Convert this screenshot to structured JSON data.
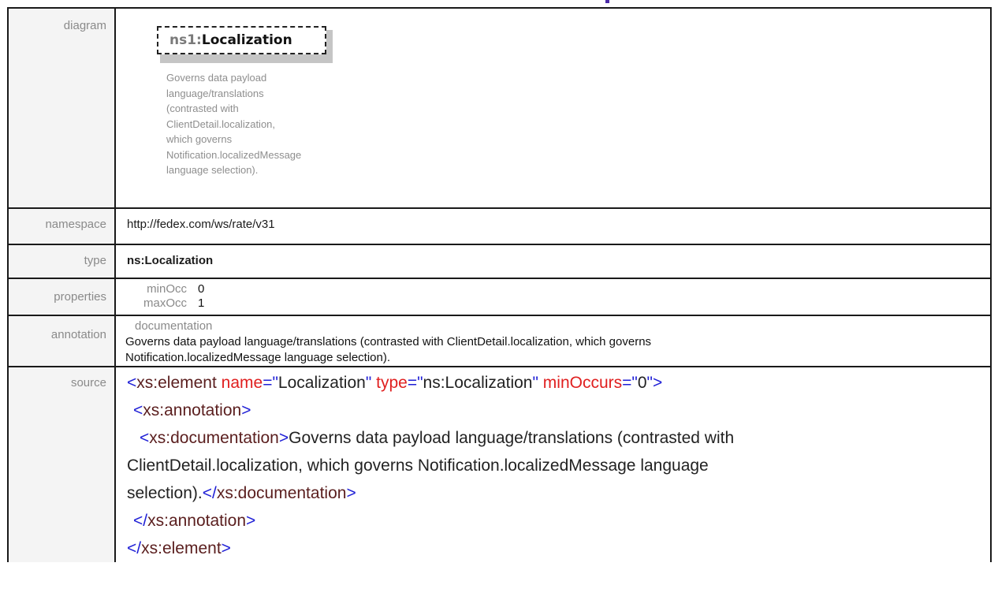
{
  "diagram": {
    "label": "diagram",
    "element_prefix": "ns1:",
    "element_name": "Localization",
    "doc_lines": [
      "Governs data payload",
      "language/translations",
      "(contrasted with",
      "ClientDetail.localization,",
      "which governs",
      "Notification.localizedMessage",
      "language selection)."
    ]
  },
  "namespace": {
    "label": "namespace",
    "value": "http://fedex.com/ws/rate/v31"
  },
  "type": {
    "label": "type",
    "value": "ns:Localization"
  },
  "properties": {
    "label": "properties",
    "items": [
      {
        "name": "minOcc",
        "value": "0"
      },
      {
        "name": "maxOcc",
        "value": "1"
      }
    ]
  },
  "annotation": {
    "label": "annotation",
    "heading": "documentation",
    "text_line1": "Governs data payload language/translations (contrasted with ClientDetail.localization,  which governs",
    "text_line2": "Notification.localizedMessage  language selection)."
  },
  "source": {
    "label": "source",
    "l1_open": "<",
    "l1_tag": "xs:element",
    "l1_attr1": "name",
    "l1_eq1": "=\"",
    "l1_val1": "Localization",
    "l1_q1": "\"",
    "l1_attr2": "type",
    "l1_eq2": "=\"",
    "l1_val2": "ns:Localization",
    "l1_q2": "\"",
    "l1_attr3": "minOccurs",
    "l1_eq3": "=\"",
    "l1_val3": "0",
    "l1_close": "\">",
    "l2_open": "<",
    "l2_tag": "xs:annotation",
    "l2_close": ">",
    "l3_open": "<",
    "l3_tag": "xs:documentation",
    "l3_close": ">",
    "l3_text": "Governs data payload language/translations (contrasted with",
    "l4_text": "ClientDetail.localization, which governs Notification.localizedMessage language",
    "l5_text": "selection).",
    "l5_endopen": "</",
    "l5_tag": "xs:documentation",
    "l5_close": ">",
    "l6_open": "</",
    "l6_tag": "xs:annotation",
    "l6_close": ">",
    "l7_open": "</",
    "l7_tag": "xs:element",
    "l7_close": ">"
  }
}
